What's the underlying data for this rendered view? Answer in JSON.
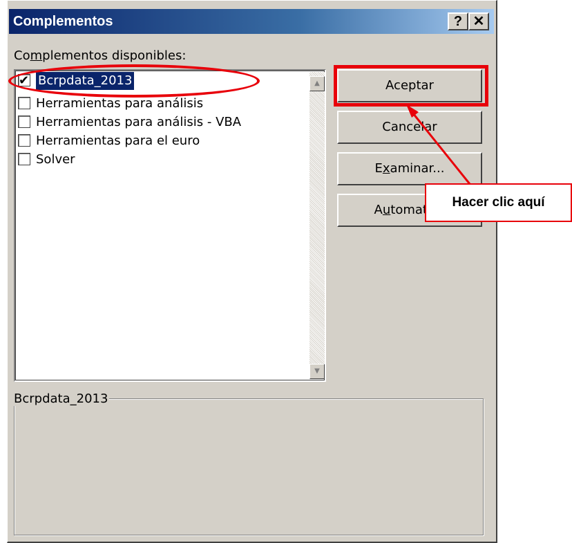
{
  "dialog": {
    "title": "Complementos",
    "help_glyph": "?",
    "close_glyph": "✕"
  },
  "available": {
    "label_prefix": "Co",
    "label_mnemonic": "m",
    "label_suffix": "plementos disponibles:",
    "items": [
      {
        "label": "Bcrpdata_2013",
        "checked": true,
        "selected": true
      },
      {
        "label": "Herramientas para análisis",
        "checked": false,
        "selected": false
      },
      {
        "label": "Herramientas para análisis - VBA",
        "checked": false,
        "selected": false
      },
      {
        "label": "Herramientas para el euro",
        "checked": false,
        "selected": false
      },
      {
        "label": "Solver",
        "checked": false,
        "selected": false
      }
    ]
  },
  "buttons": {
    "accept": "Aceptar",
    "cancel": "Cancelar",
    "browse_prefix": "E",
    "browse_mnemonic": "x",
    "browse_suffix": "aminar...",
    "auto_prefix": "A",
    "auto_mnemonic": "u",
    "auto_suffix": "tomatiza"
  },
  "description": {
    "group_label": "Bcrpdata_2013"
  },
  "annotation": {
    "callout_text": "Hacer clic aquí",
    "color": "#e8000a"
  },
  "colors": {
    "title_start": "#0a246a",
    "title_end": "#a6caf0",
    "dialog_bg": "#d4d0c8",
    "selection": "#0a246a"
  }
}
